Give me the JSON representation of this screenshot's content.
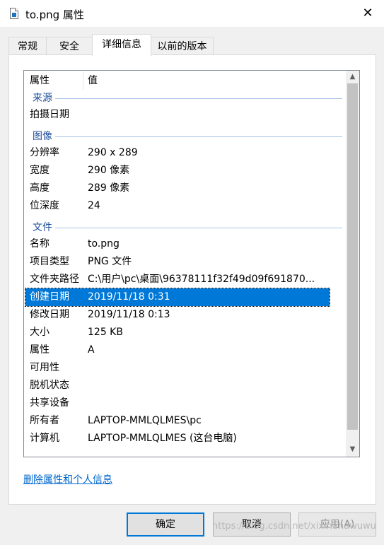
{
  "window": {
    "title": "to.png 属性",
    "close_glyph": "✕"
  },
  "tabs": [
    {
      "label": "常规",
      "active": false
    },
    {
      "label": "安全",
      "active": false
    },
    {
      "label": "详细信息",
      "active": true
    },
    {
      "label": "以前的版本",
      "active": false
    }
  ],
  "table": {
    "col_property": "属性",
    "col_value": "值",
    "groups": {
      "source": "来源",
      "image": "图像",
      "file": "文件"
    },
    "rows": [
      {
        "key": "拍摄日期",
        "value": ""
      },
      {
        "key": "分辨率",
        "value": "290 x 289"
      },
      {
        "key": "宽度",
        "value": "290 像素"
      },
      {
        "key": "高度",
        "value": "289 像素"
      },
      {
        "key": "位深度",
        "value": "24"
      },
      {
        "key": "名称",
        "value": "to.png"
      },
      {
        "key": "项目类型",
        "value": "PNG 文件"
      },
      {
        "key": "文件夹路径",
        "value": "C:\\用户\\pc\\桌面\\96378111f32f49d09f691870..."
      },
      {
        "key": "创建日期",
        "value": "2019/11/18 0:31",
        "selected": true
      },
      {
        "key": "修改日期",
        "value": "2019/11/18 0:13"
      },
      {
        "key": "大小",
        "value": "125 KB"
      },
      {
        "key": "属性",
        "value": "A"
      },
      {
        "key": "可用性",
        "value": ""
      },
      {
        "key": "脱机状态",
        "value": ""
      },
      {
        "key": "共享设备",
        "value": ""
      },
      {
        "key": "所有者",
        "value": "LAPTOP-MMLQLMES\\pc"
      },
      {
        "key": "计算机",
        "value": "LAPTOP-MMLQLMES (这台电脑)"
      }
    ]
  },
  "scrollbar": {
    "up_glyph": "▲",
    "down_glyph": "▼"
  },
  "link": {
    "remove_properties": "删除属性和个人信息"
  },
  "buttons": {
    "ok": "确定",
    "cancel": "取消",
    "apply": "应用(A)"
  },
  "watermark": "https://blog.csdn.net/xixihahawuwu",
  "colors": {
    "selection": "#0078d7",
    "link": "#0066cc",
    "group_label": "#1e4e9c"
  }
}
